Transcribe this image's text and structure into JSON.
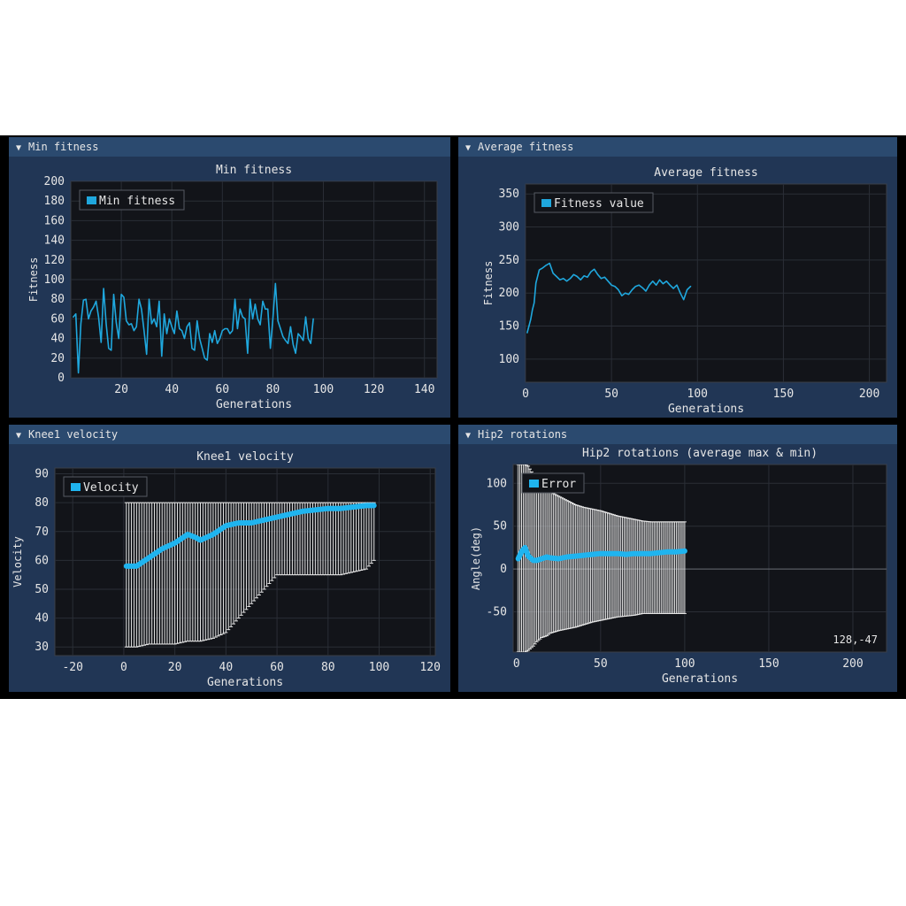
{
  "panels": [
    {
      "window_title": "Min fitness",
      "collapse_icon": "triangle-down-icon",
      "chart": {
        "type": "line",
        "title": "Min fitness",
        "xlabel": "Generations",
        "ylabel": "Fitness",
        "xlim": [
          0,
          145
        ],
        "ylim": [
          0,
          200
        ],
        "xticks": [
          20,
          40,
          60,
          80,
          100,
          120,
          140
        ],
        "yticks": [
          0,
          20,
          40,
          60,
          80,
          100,
          120,
          140,
          160,
          180,
          200
        ],
        "grid": true,
        "legend": "top-left",
        "series": [
          {
            "name": "Min fitness",
            "color": "#1fa7dd",
            "x": [
              1,
              2,
              3,
              4,
              5,
              6,
              7,
              8,
              9,
              10,
              11,
              12,
              13,
              14,
              15,
              16,
              17,
              18,
              19,
              20,
              21,
              22,
              23,
              24,
              25,
              26,
              27,
              28,
              29,
              30,
              31,
              32,
              33,
              34,
              35,
              36,
              37,
              38,
              39,
              40,
              41,
              42,
              43,
              44,
              45,
              46,
              47,
              48,
              49,
              50,
              51,
              52,
              53,
              54,
              55,
              56,
              57,
              58,
              59,
              60,
              61,
              62,
              63,
              64,
              65,
              66,
              67,
              68,
              69,
              70,
              71,
              72,
              73,
              74,
              75,
              76,
              77,
              78,
              79,
              80,
              81,
              82,
              83,
              84,
              85,
              86,
              87,
              88,
              89,
              90,
              91,
              92,
              93,
              94,
              95,
              96
            ],
            "y": [
              62,
              65,
              5,
              55,
              79,
              80,
              60,
              68,
              72,
              78,
              62,
              36,
              91,
              55,
              30,
              28,
              85,
              56,
              40,
              85,
              82,
              58,
              54,
              55,
              48,
              52,
              80,
              70,
              48,
              24,
              80,
              55,
              60,
              52,
              78,
              22,
              65,
              45,
              60,
              52,
              45,
              68,
              50,
              48,
              40,
              52,
              56,
              30,
              28,
              58,
              40,
              30,
              20,
              18,
              45,
              36,
              48,
              35,
              40,
              48,
              50,
              50,
              45,
              48,
              80,
              50,
              70,
              62,
              60,
              25,
              80,
              60,
              75,
              60,
              54,
              78,
              70,
              70,
              30,
              60,
              96,
              58,
              50,
              42,
              38,
              35,
              52,
              34,
              25,
              45,
              42,
              38,
              62,
              40,
              35,
              60
            ]
          }
        ]
      }
    },
    {
      "window_title": "Average fitness",
      "collapse_icon": "triangle-down-icon",
      "chart": {
        "type": "line",
        "title": "Average fitness",
        "xlabel": "Generations",
        "ylabel": "Fitness",
        "xlim": [
          0,
          210
        ],
        "ylim": [
          65,
          365
        ],
        "xticks": [
          0,
          50,
          100,
          150,
          200
        ],
        "yticks": [
          100,
          150,
          200,
          250,
          300,
          350
        ],
        "grid": true,
        "legend": "top-left",
        "series": [
          {
            "name": "Fitness value",
            "color": "#1fa7dd",
            "x": [
              1,
              3,
              4,
              5,
              6,
              8,
              10,
              12,
              14,
              16,
              18,
              20,
              22,
              24,
              26,
              28,
              30,
              32,
              34,
              36,
              38,
              40,
              42,
              44,
              46,
              48,
              50,
              52,
              54,
              56,
              58,
              60,
              62,
              64,
              66,
              68,
              70,
              72,
              74,
              76,
              78,
              80,
              82,
              84,
              86,
              88,
              90,
              92,
              94,
              96
            ],
            "y": [
              140,
              160,
              175,
              185,
              215,
              235,
              238,
              242,
              245,
              230,
              225,
              220,
              222,
              218,
              222,
              228,
              225,
              220,
              226,
              224,
              232,
              236,
              228,
              222,
              224,
              218,
              212,
              210,
              205,
              196,
              200,
              198,
              205,
              210,
              212,
              208,
              203,
              212,
              218,
              212,
              220,
              214,
              218,
              212,
              207,
              212,
              200,
              190,
              205,
              210
            ]
          }
        ]
      }
    },
    {
      "window_title": "Knee1 velocity",
      "collapse_icon": "triangle-down-icon",
      "chart": {
        "type": "line",
        "title": "Knee1 velocity",
        "xlabel": "Generations",
        "ylabel": "Velocity",
        "xlim": [
          -27,
          122
        ],
        "ylim": [
          27,
          92
        ],
        "xticks": [
          -20,
          0,
          20,
          40,
          60,
          80,
          100,
          120
        ],
        "yticks": [
          30,
          40,
          50,
          60,
          70,
          80,
          90
        ],
        "grid": true,
        "legend": "top-left",
        "series": [
          {
            "name": "Velocity",
            "color": "#1fb4ef",
            "x": [
              1,
              5,
              10,
              15,
              20,
              25,
              28,
              30,
              35,
              40,
              45,
              50,
              55,
              60,
              65,
              70,
              75,
              80,
              85,
              90,
              95,
              98
            ],
            "y": [
              58,
              58,
              61,
              64,
              66,
              69,
              68,
              67,
              69,
              72,
              73,
              73,
              74,
              75,
              76,
              77,
              77.5,
              78,
              78,
              78.5,
              79,
              79
            ],
            "error_bar_color": "#e6e6e6",
            "error_bar_step": 1,
            "upper": [
              80,
              80,
              80,
              80,
              80,
              80,
              80,
              80,
              80,
              80,
              80,
              80,
              80,
              80,
              80,
              80,
              80,
              80,
              80,
              80,
              80,
              80
            ],
            "lower": [
              30,
              30,
              31,
              31,
              31,
              32,
              32,
              32,
              33,
              35,
              40,
              45,
              50,
              55,
              55,
              55,
              55,
              55,
              55,
              56,
              57,
              60
            ]
          }
        ]
      }
    },
    {
      "window_title": "Hip2 rotations",
      "collapse_icon": "triangle-down-icon",
      "mouse_readout": "128,-47",
      "chart": {
        "type": "line",
        "title": "Hip2 rotations (average max & min)",
        "xlabel": "Generations",
        "ylabel": "Angle(deg)",
        "xlim": [
          -2,
          220
        ],
        "ylim": [
          -97,
          122
        ],
        "xticks": [
          0,
          50,
          100,
          150,
          200
        ],
        "yticks": [
          -50,
          0,
          50,
          100
        ],
        "grid": true,
        "zero_line": true,
        "legend": "top-left",
        "series": [
          {
            "name": "Error",
            "color": "#1fb4ef",
            "x": [
              1,
              3,
              5,
              7,
              10,
              12,
              15,
              18,
              20,
              25,
              30,
              35,
              40,
              45,
              50,
              55,
              60,
              65,
              70,
              75,
              80,
              85,
              90,
              95,
              100
            ],
            "y": [
              12,
              20,
              25,
              15,
              10,
              10,
              12,
              14,
              13,
              12,
              14,
              15,
              16,
              17,
              18,
              18,
              18,
              17,
              18,
              18,
              18,
              19,
              20,
              20,
              21
            ],
            "error_bar_color": "#e6e6e6",
            "error_bar_step": 1,
            "upper": [
              122,
              122,
              122,
              120,
              110,
              105,
              100,
              95,
              90,
              85,
              80,
              75,
              72,
              70,
              68,
              65,
              62,
              60,
              58,
              56,
              55,
              55,
              55,
              55,
              55
            ],
            "lower": [
              -97,
              -97,
              -97,
              -95,
              -90,
              -85,
              -80,
              -78,
              -75,
              -72,
              -70,
              -68,
              -65,
              -62,
              -60,
              -58,
              -56,
              -55,
              -54,
              -52,
              -52,
              -52,
              -52,
              -52,
              -52
            ]
          }
        ]
      }
    }
  ]
}
